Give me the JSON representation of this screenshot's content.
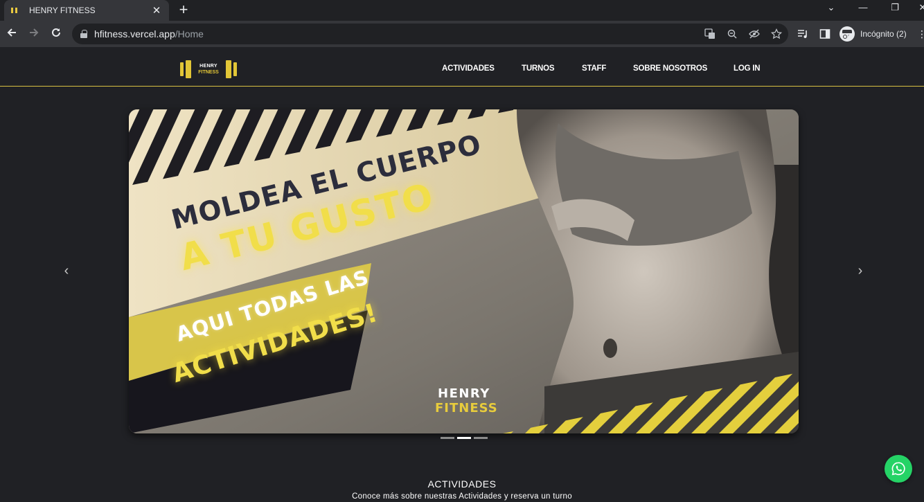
{
  "browser": {
    "tab_title": "HENRY FITNESS",
    "tab_close": "✕",
    "new_tab": "+",
    "url_host": "hfitness.vercel.app",
    "url_path": "/Home",
    "profile_label": "Incógnito (2)",
    "window_controls": {
      "tablist": "⌄",
      "minimize": "—",
      "restore": "❐",
      "close": "✕"
    }
  },
  "header": {
    "logo": {
      "line1": "HENRY",
      "line2": "FITNESS"
    },
    "nav": [
      {
        "label": "ACTIVIDADES"
      },
      {
        "label": "TURNOS"
      },
      {
        "label": "STAFF"
      },
      {
        "label": "SOBRE NOSOTROS"
      },
      {
        "label": "LOG IN"
      }
    ]
  },
  "carousel": {
    "prev_arrow": "‹",
    "next_arrow": "›",
    "slide": {
      "headline_1": "MOLDEA EL CUERPO",
      "headline_2": "A TU GUSTO",
      "cta_1": "AQUI TODAS LAS",
      "cta_2": "ACTIVIDADES!",
      "brand_1": "HENRY",
      "brand_2": "FITNESS"
    },
    "active_index": 1,
    "slide_count": 3
  },
  "section": {
    "title": "ACTIVIDADES",
    "subtitle": "Conoce más sobre nuestras Actividades y reserva un turno"
  },
  "colors": {
    "background": "#202125",
    "accent": "#e2c637",
    "whatsapp": "#25d366"
  }
}
